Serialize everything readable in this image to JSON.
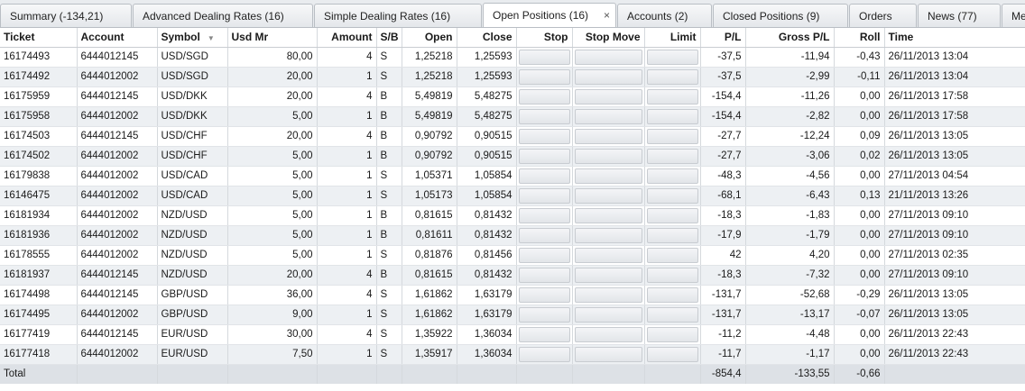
{
  "tabs": [
    {
      "label": "Summary (-134,21)"
    },
    {
      "label": "Advanced Dealing Rates (16)"
    },
    {
      "label": "Simple Dealing Rates (16)"
    },
    {
      "label": "Open Positions (16)",
      "active": true,
      "close": "×"
    },
    {
      "label": "Accounts (2)"
    },
    {
      "label": "Closed Positions (9)"
    },
    {
      "label": "Orders"
    },
    {
      "label": "News (77)"
    },
    {
      "label": "Me"
    }
  ],
  "columns": {
    "ticket": "Ticket",
    "account": "Account",
    "symbol": "Symbol",
    "usd_mr": "Usd Mr",
    "amount": "Amount",
    "sb": "S/B",
    "open": "Open",
    "close": "Close",
    "stop": "Stop",
    "stop_move": "Stop Move",
    "limit": "Limit",
    "pl": "P/L",
    "gross_pl": "Gross P/L",
    "roll": "Roll",
    "time": "Time"
  },
  "rows": [
    {
      "ticket": "16174493",
      "account": "6444012145",
      "symbol": "USD/SGD",
      "usd_mr": "80,00",
      "amount": "4",
      "sb": "S",
      "open": "1,25218",
      "close": "1,25593",
      "pl": "-37,5",
      "gross_pl": "-11,94",
      "roll": "-0,43",
      "time": "26/11/2013 13:04"
    },
    {
      "ticket": "16174492",
      "account": "6444012002",
      "symbol": "USD/SGD",
      "usd_mr": "20,00",
      "amount": "1",
      "sb": "S",
      "open": "1,25218",
      "close": "1,25593",
      "pl": "-37,5",
      "gross_pl": "-2,99",
      "roll": "-0,11",
      "time": "26/11/2013 13:04"
    },
    {
      "ticket": "16175959",
      "account": "6444012145",
      "symbol": "USD/DKK",
      "usd_mr": "20,00",
      "amount": "4",
      "sb": "B",
      "open": "5,49819",
      "close": "5,48275",
      "pl": "-154,4",
      "gross_pl": "-11,26",
      "roll": "0,00",
      "time": "26/11/2013 17:58"
    },
    {
      "ticket": "16175958",
      "account": "6444012002",
      "symbol": "USD/DKK",
      "usd_mr": "5,00",
      "amount": "1",
      "sb": "B",
      "open": "5,49819",
      "close": "5,48275",
      "pl": "-154,4",
      "gross_pl": "-2,82",
      "roll": "0,00",
      "time": "26/11/2013 17:58"
    },
    {
      "ticket": "16174503",
      "account": "6444012145",
      "symbol": "USD/CHF",
      "usd_mr": "20,00",
      "amount": "4",
      "sb": "B",
      "open": "0,90792",
      "close": "0,90515",
      "pl": "-27,7",
      "gross_pl": "-12,24",
      "roll": "0,09",
      "time": "26/11/2013 13:05"
    },
    {
      "ticket": "16174502",
      "account": "6444012002",
      "symbol": "USD/CHF",
      "usd_mr": "5,00",
      "amount": "1",
      "sb": "B",
      "open": "0,90792",
      "close": "0,90515",
      "pl": "-27,7",
      "gross_pl": "-3,06",
      "roll": "0,02",
      "time": "26/11/2013 13:05"
    },
    {
      "ticket": "16179838",
      "account": "6444012002",
      "symbol": "USD/CAD",
      "usd_mr": "5,00",
      "amount": "1",
      "sb": "S",
      "open": "1,05371",
      "close": "1,05854",
      "pl": "-48,3",
      "gross_pl": "-4,56",
      "roll": "0,00",
      "time": "27/11/2013 04:54"
    },
    {
      "ticket": "16146475",
      "account": "6444012002",
      "symbol": "USD/CAD",
      "usd_mr": "5,00",
      "amount": "1",
      "sb": "S",
      "open": "1,05173",
      "close": "1,05854",
      "pl": "-68,1",
      "gross_pl": "-6,43",
      "roll": "0,13",
      "time": "21/11/2013 13:26"
    },
    {
      "ticket": "16181934",
      "account": "6444012002",
      "symbol": "NZD/USD",
      "usd_mr": "5,00",
      "amount": "1",
      "sb": "B",
      "open": "0,81615",
      "close": "0,81432",
      "pl": "-18,3",
      "gross_pl": "-1,83",
      "roll": "0,00",
      "time": "27/11/2013 09:10"
    },
    {
      "ticket": "16181936",
      "account": "6444012002",
      "symbol": "NZD/USD",
      "usd_mr": "5,00",
      "amount": "1",
      "sb": "B",
      "open": "0,81611",
      "close": "0,81432",
      "pl": "-17,9",
      "gross_pl": "-1,79",
      "roll": "0,00",
      "time": "27/11/2013 09:10"
    },
    {
      "ticket": "16178555",
      "account": "6444012002",
      "symbol": "NZD/USD",
      "usd_mr": "5,00",
      "amount": "1",
      "sb": "S",
      "open": "0,81876",
      "close": "0,81456",
      "pl": "42",
      "gross_pl": "4,20",
      "roll": "0,00",
      "time": "27/11/2013 02:35"
    },
    {
      "ticket": "16181937",
      "account": "6444012145",
      "symbol": "NZD/USD",
      "usd_mr": "20,00",
      "amount": "4",
      "sb": "B",
      "open": "0,81615",
      "close": "0,81432",
      "pl": "-18,3",
      "gross_pl": "-7,32",
      "roll": "0,00",
      "time": "27/11/2013 09:10"
    },
    {
      "ticket": "16174498",
      "account": "6444012145",
      "symbol": "GBP/USD",
      "usd_mr": "36,00",
      "amount": "4",
      "sb": "S",
      "open": "1,61862",
      "close": "1,63179",
      "pl": "-131,7",
      "gross_pl": "-52,68",
      "roll": "-0,29",
      "time": "26/11/2013 13:05"
    },
    {
      "ticket": "16174495",
      "account": "6444012002",
      "symbol": "GBP/USD",
      "usd_mr": "9,00",
      "amount": "1",
      "sb": "S",
      "open": "1,61862",
      "close": "1,63179",
      "pl": "-131,7",
      "gross_pl": "-13,17",
      "roll": "-0,07",
      "time": "26/11/2013 13:05"
    },
    {
      "ticket": "16177419",
      "account": "6444012145",
      "symbol": "EUR/USD",
      "usd_mr": "30,00",
      "amount": "4",
      "sb": "S",
      "open": "1,35922",
      "close": "1,36034",
      "pl": "-11,2",
      "gross_pl": "-4,48",
      "roll": "0,00",
      "time": "26/11/2013 22:43"
    },
    {
      "ticket": "16177418",
      "account": "6444012002",
      "symbol": "EUR/USD",
      "usd_mr": "7,50",
      "amount": "1",
      "sb": "S",
      "open": "1,35917",
      "close": "1,36034",
      "pl": "-11,7",
      "gross_pl": "-1,17",
      "roll": "0,00",
      "time": "26/11/2013 22:43"
    }
  ],
  "total": {
    "label": "Total",
    "pl": "-854,4",
    "gross_pl": "-133,55",
    "roll": "-0,66"
  },
  "icons": {
    "sort": "sort-down-icon",
    "close": "close-icon"
  }
}
